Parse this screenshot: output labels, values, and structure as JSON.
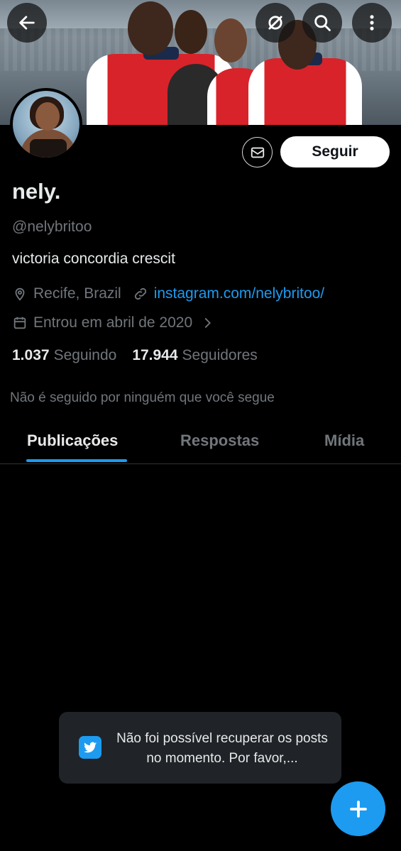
{
  "header": {
    "back_icon": "arrow-left-icon",
    "grok_icon": "grok-icon",
    "search_icon": "search-icon",
    "more_icon": "more-vertical-icon"
  },
  "profile": {
    "name": "nely.",
    "handle": "@nelybritoo",
    "bio": "victoria concordia crescit",
    "location": "Recife, Brazil",
    "website": "instagram.com/nelybritoo/",
    "joined": "Entrou em abril de 2020",
    "following_count": "1.037",
    "following_label": "Seguindo",
    "followers_count": "17.944",
    "followers_label": "Seguidores",
    "not_followed_text": "Não é seguido por ninguém que você segue"
  },
  "actions": {
    "follow_label": "Seguir",
    "message_icon": "envelope-icon"
  },
  "tabs": [
    {
      "label": "Publicações",
      "active": true
    },
    {
      "label": "Respostas",
      "active": false
    },
    {
      "label": "Mídia",
      "active": false
    }
  ],
  "toast": {
    "text": "Não foi possível recuperar os posts no momento. Por favor,..."
  },
  "colors": {
    "accent": "#1d9bf0",
    "background": "#000000",
    "muted": "#71767b"
  }
}
